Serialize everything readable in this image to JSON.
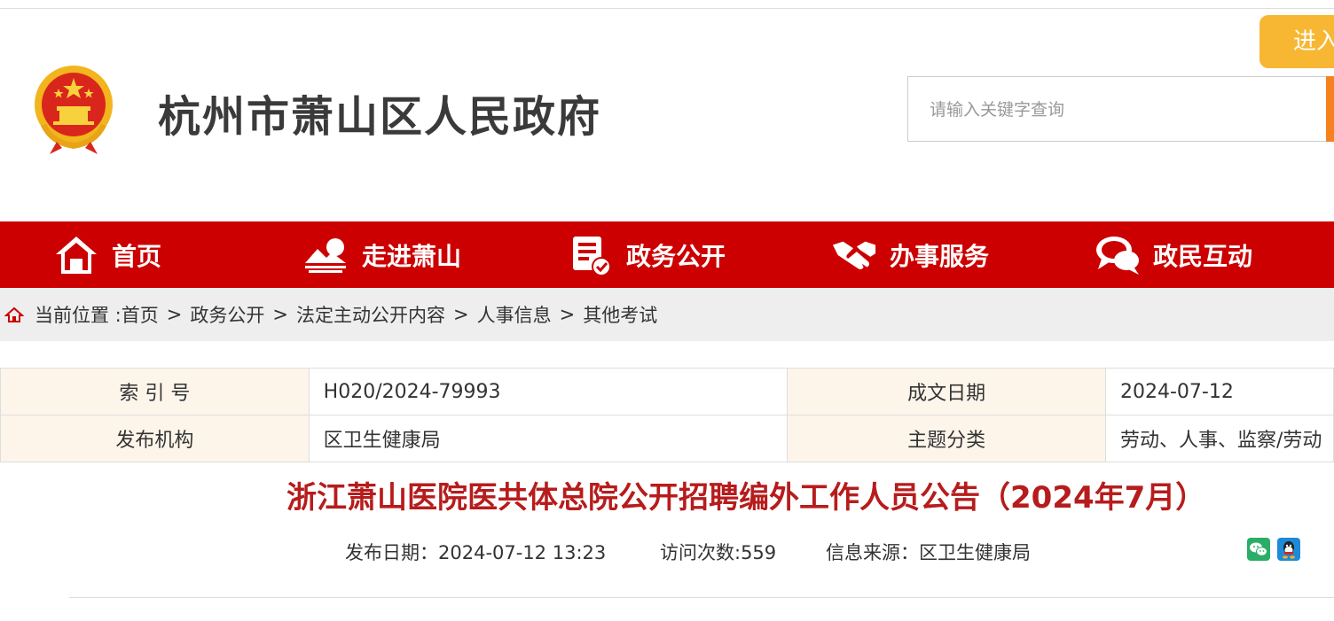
{
  "header": {
    "site_title": "杭州市萧山区人民政府",
    "enter_button": "进入",
    "search_placeholder": "请输入关键字查询"
  },
  "nav": [
    {
      "label": "首页",
      "icon": "home-icon"
    },
    {
      "label": "走进萧山",
      "icon": "landscape-icon"
    },
    {
      "label": "政务公开",
      "icon": "document-check-icon"
    },
    {
      "label": "办事服务",
      "icon": "handshake-icon"
    },
    {
      "label": "政民互动",
      "icon": "chat-bubbles-icon"
    }
  ],
  "breadcrumb": {
    "prefix": "当前位置 :",
    "items": [
      "首页",
      "政务公开",
      "法定主动公开内容",
      "人事信息",
      "其他考试"
    ],
    "separator": ">"
  },
  "meta": {
    "index_label": "索 引 号",
    "index_value": "H020/2024-79993",
    "date_label": "成文日期",
    "date_value": "2024-07-12",
    "org_label": "发布机构",
    "org_value": "区卫生健康局",
    "topic_label": "主题分类",
    "topic_value": "劳动、人事、监察/劳动"
  },
  "article": {
    "title": "浙江萧山医院医共体总院公开招聘编外工作人员公告（2024年7月）",
    "publish_date": "发布日期：2024-07-12 13:23",
    "visits": "访问次数:559",
    "source": "信息来源：区卫生健康局"
  },
  "colors": {
    "nav_red": "#cc0000",
    "title_red": "#b71c1c",
    "enter_yellow": "#f7b733",
    "search_accent": "#f5821f"
  }
}
